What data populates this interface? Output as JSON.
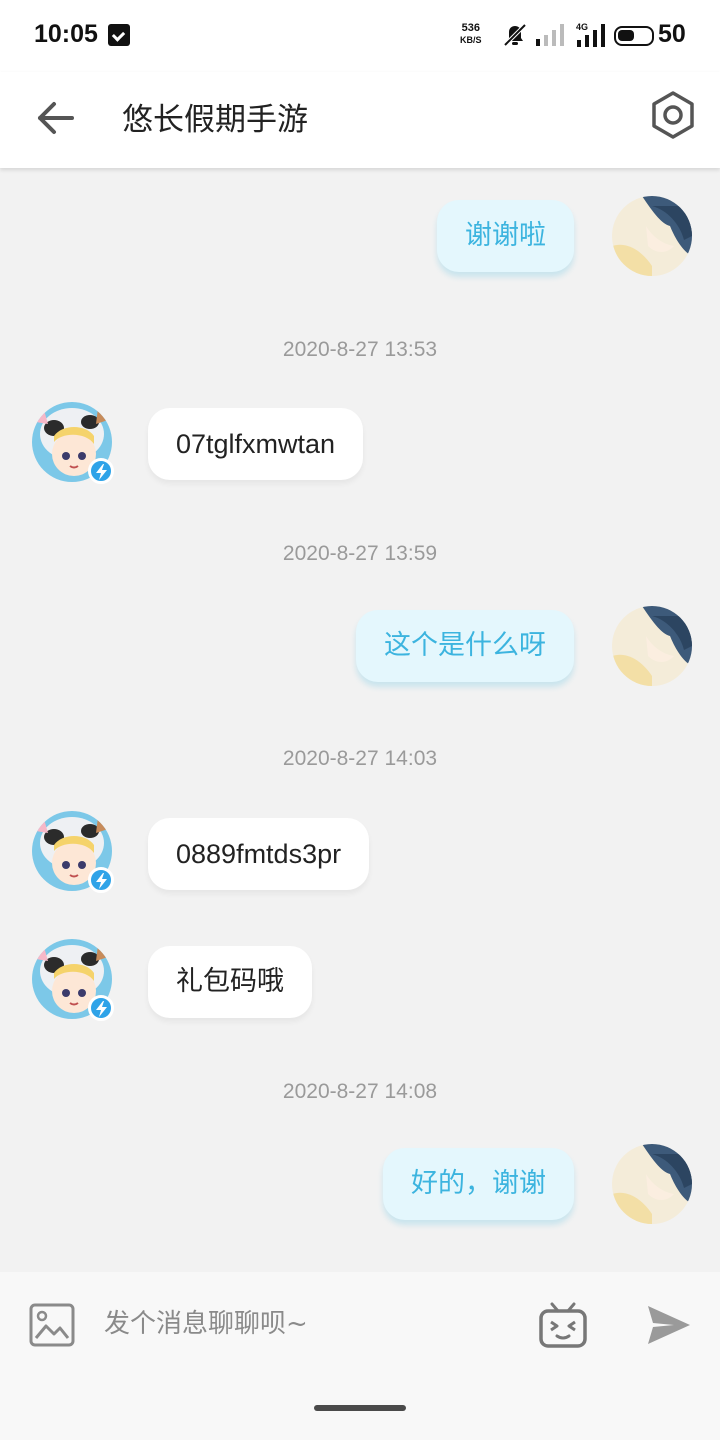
{
  "status_bar": {
    "time": "10:05",
    "net_speed_value": "536",
    "net_speed_unit": "KB/S",
    "network_type": "4G",
    "battery_level": "50"
  },
  "header": {
    "title": "悠长假期手游"
  },
  "messages": [
    {
      "type": "message",
      "side": "out",
      "text": "谢谢啦"
    },
    {
      "type": "timestamp",
      "text": "2020-8-27 13:53"
    },
    {
      "type": "message",
      "side": "in",
      "text": "07tglfxmwtan"
    },
    {
      "type": "timestamp",
      "text": "2020-8-27 13:59"
    },
    {
      "type": "message",
      "side": "out",
      "text": "这个是什么呀"
    },
    {
      "type": "timestamp",
      "text": "2020-8-27 14:03"
    },
    {
      "type": "message",
      "side": "in",
      "text": "0889fmtds3pr"
    },
    {
      "type": "message",
      "side": "in",
      "text": "礼包码哦"
    },
    {
      "type": "timestamp",
      "text": "2020-8-27 14:08"
    },
    {
      "type": "message",
      "side": "out",
      "text": "好的，谢谢"
    }
  ],
  "input": {
    "placeholder": "发个消息聊聊呗~"
  },
  "colors": {
    "outgoing_bubble_bg": "#e4f7fd",
    "outgoing_text": "#3cb4df",
    "incoming_bubble_bg": "#ffffff",
    "background": "#f2f2f2",
    "badge": "#2fa3e8"
  },
  "icons": {
    "back": "arrow-left-icon",
    "settings": "hexagon-gear-icon",
    "image": "image-icon",
    "emoji": "tv-face-emoji-icon",
    "send": "paper-plane-send-icon",
    "badge": "lightning-badge-icon"
  }
}
